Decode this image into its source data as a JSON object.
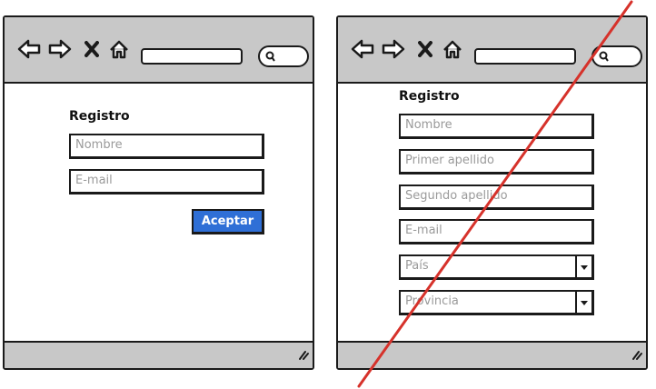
{
  "left_window": {
    "form_title": "Registro",
    "fields": [
      {
        "placeholder": "Nombre"
      },
      {
        "placeholder": "E-mail"
      }
    ],
    "submit_label": "Aceptar"
  },
  "right_window": {
    "form_title": "Registro",
    "fields": [
      {
        "placeholder": "Nombre",
        "type": "text"
      },
      {
        "placeholder": "Primer apellido",
        "type": "text"
      },
      {
        "placeholder": "Segundo apellido",
        "type": "text"
      },
      {
        "placeholder": "E-mail",
        "type": "text"
      },
      {
        "placeholder": "País",
        "type": "select"
      },
      {
        "placeholder": "Provincia",
        "type": "select"
      }
    ],
    "crossed_out": true
  },
  "icons": [
    "back-arrow-icon",
    "forward-arrow-icon",
    "close-icon",
    "home-icon",
    "search-icon",
    "resize-grip-icon"
  ],
  "colors": {
    "chrome": "#c8c8c8",
    "button": "#2f6fd6",
    "strike": "#d6322b",
    "placeholder": "#9a9a9a"
  }
}
